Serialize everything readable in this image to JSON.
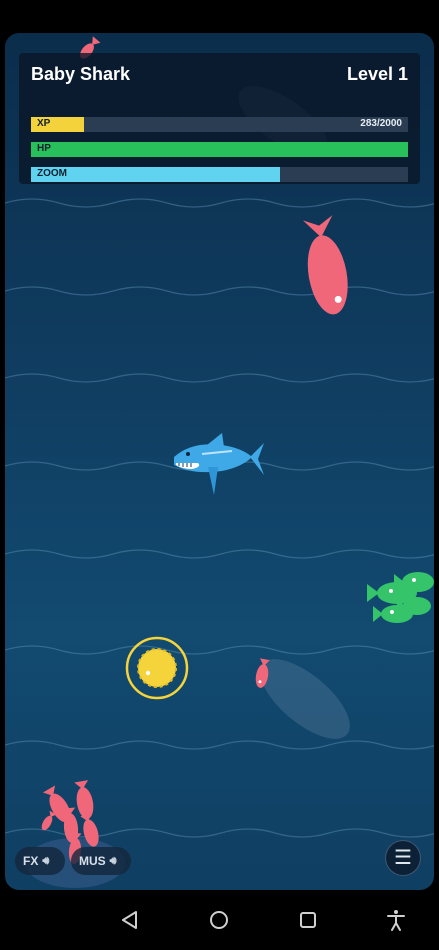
{
  "hud": {
    "title": "Baby Shark",
    "level": "Level 1",
    "xp": {
      "label": "XP",
      "value_text": "283/2000",
      "fraction": 0.1415,
      "color": "#f3d23b"
    },
    "hp": {
      "label": "HP",
      "fraction": 1.0,
      "color": "#28c05a"
    },
    "zoom": {
      "label": "ZOOM",
      "fraction": 0.66,
      "color": "#5fd3f0"
    }
  },
  "controls": {
    "fx_label": "FX",
    "mus_label": "MUS",
    "speaker_icon": "speaker-icon",
    "menu_icon": "hamburger-menu-icon"
  },
  "navbar": {
    "icons": [
      "back-triangle-icon",
      "home-circle-icon",
      "recents-square-icon",
      "accessibility-icon"
    ]
  },
  "colors": {
    "ocean_top": "#0b2d4c",
    "ocean_mid": "#124a70",
    "player_shark": "#3fa9e8",
    "prey_fish": "#f0677a",
    "green_fish": "#35c46a",
    "coin": "#f5d33a"
  }
}
